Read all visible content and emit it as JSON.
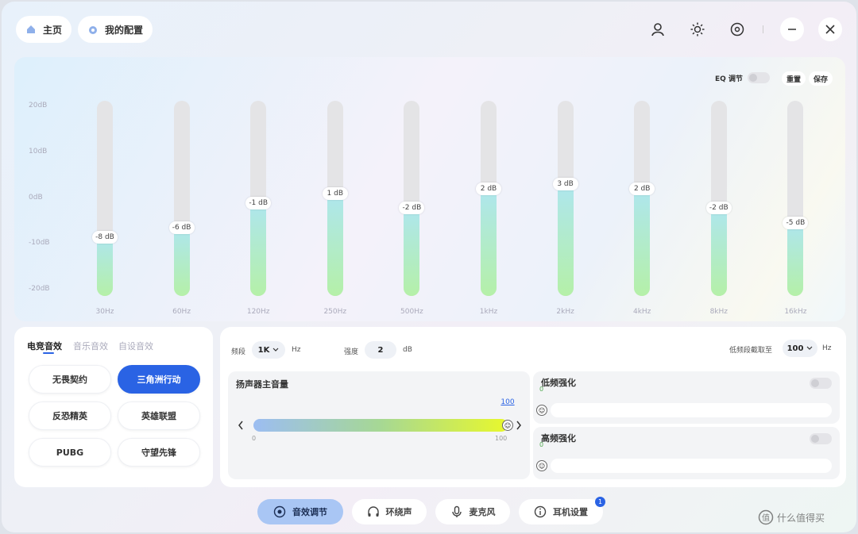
{
  "header": {
    "home_label": "主页",
    "config_label": "我的配置",
    "icons": [
      "user-icon",
      "brightness-icon",
      "target-icon",
      "minimize-icon",
      "close-icon"
    ]
  },
  "eq": {
    "toggle_label": "EQ 调节",
    "reset_label": "重置",
    "save_label": "保存",
    "y_labels": [
      "20dB",
      "10dB",
      "0dB",
      "-10dB",
      "-20dB"
    ],
    "bands": [
      {
        "freq": "30Hz",
        "gain": -8,
        "gain_label": "-8 dB"
      },
      {
        "freq": "60Hz",
        "gain": -6,
        "gain_label": "-6 dB"
      },
      {
        "freq": "120Hz",
        "gain": -1,
        "gain_label": "-1 dB"
      },
      {
        "freq": "250Hz",
        "gain": 1,
        "gain_label": "1 dB"
      },
      {
        "freq": "500Hz",
        "gain": -2,
        "gain_label": "-2 dB"
      },
      {
        "freq": "1kHz",
        "gain": 2,
        "gain_label": "2 dB"
      },
      {
        "freq": "2kHz",
        "gain": 3,
        "gain_label": "3 dB"
      },
      {
        "freq": "4kHz",
        "gain": 2,
        "gain_label": "2 dB"
      },
      {
        "freq": "8kHz",
        "gain": -2,
        "gain_label": "-2 dB"
      },
      {
        "freq": "16kHz",
        "gain": -5,
        "gain_label": "-5 dB"
      }
    ]
  },
  "presets": {
    "tabs": [
      "电竞音效",
      "音乐音效",
      "自设音效"
    ],
    "items": [
      "无畏契约",
      "三角洲行动",
      "反恐精英",
      "英雄联盟",
      "PUBG",
      "守望先锋"
    ],
    "selected_index": 1
  },
  "params": {
    "freq_label": "频段",
    "freq_value": "1K",
    "freq_unit": "Hz",
    "gain_label": "强度",
    "gain_value": "2",
    "gain_unit": "dB",
    "split_label": "低频段截取至",
    "split_value": "100",
    "split_unit": "Hz",
    "master_title": "扬声器主音量",
    "master_value": "100",
    "master_level": 1.0,
    "master_min": "0",
    "master_max": "100",
    "bass_title": "低频强化",
    "bass_value": "0",
    "treble_title": "高频强化",
    "treble_value": "0"
  },
  "nav": {
    "items": [
      "音效调节",
      "环绕声",
      "麦克风",
      "耳机设置"
    ],
    "active_index": 0,
    "badge": "1"
  },
  "watermark": "什么值得买"
}
